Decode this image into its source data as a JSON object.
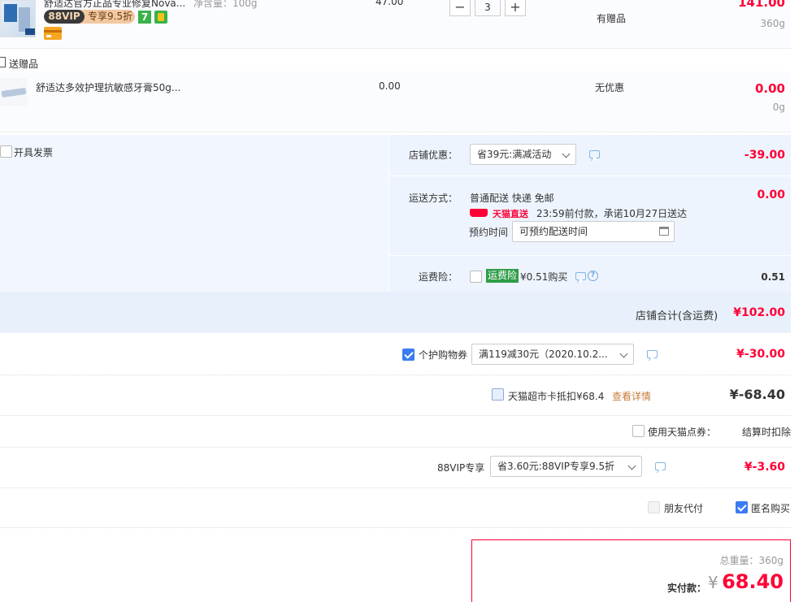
{
  "item1": {
    "title": "舒适达官方正品专业修复Nova...",
    "spec": "净含量：100g",
    "price": "47.00",
    "quantity": "3",
    "vip_label": "88VIP",
    "vip_discount": "专享9.5折",
    "badge_seven": "7",
    "promo": "有赠品",
    "total": "141.00",
    "weight": "360g"
  },
  "gift": {
    "section_label": "送赠品",
    "title": "舒适达多效护理抗敏感牙膏50g...",
    "price": "0.00",
    "promo": "无优惠",
    "total": "0.00",
    "weight": "0g"
  },
  "invoice": {
    "label": "开具发票"
  },
  "shop_discount": {
    "label": "店铺优惠：",
    "value": "省39元:满减活动",
    "amount": "-39.00"
  },
  "shipping": {
    "label": "运送方式：",
    "method": "普通配送 快递 免邮",
    "brand": "天猫直送",
    "promise": "23:59前付款，承诺10月27日送达",
    "reserve_label": "预约时间",
    "reserve_placeholder": "可预约配送时间",
    "amount": "0.00"
  },
  "insurance": {
    "label": "运费险：",
    "tag": "运费险",
    "price_text": "¥0.51购买",
    "amount": "0.51"
  },
  "shop_total": {
    "label": "店铺合计(含运费)",
    "amount": "¥102.00"
  },
  "coupon": {
    "label": "个护购物券",
    "value": "满119减30元（2020.10.2...",
    "amount": "¥-30.00"
  },
  "card": {
    "label": "天猫超市卡抵扣¥68.4",
    "link": "查看详情",
    "amount": "¥-68.40"
  },
  "points": {
    "label": "使用天猫点券：",
    "note": "结算时扣除"
  },
  "vip88": {
    "label": "88VIP专享",
    "value": "省3.60元:88VIP专享9.5折",
    "amount": "¥-3.60"
  },
  "options": {
    "friend_pay": "朋友代付",
    "anonymous": "匿名购买"
  },
  "summary": {
    "weight_label": "总重量：360g",
    "pay_label": "实付款：",
    "currency": "¥",
    "amount": "68.40"
  },
  "colors": {
    "accent_red": "#ff0036",
    "panel_bg": "#f2f7ff",
    "link_orange": "#c67c3b",
    "check_blue": "#3b7cf0"
  }
}
